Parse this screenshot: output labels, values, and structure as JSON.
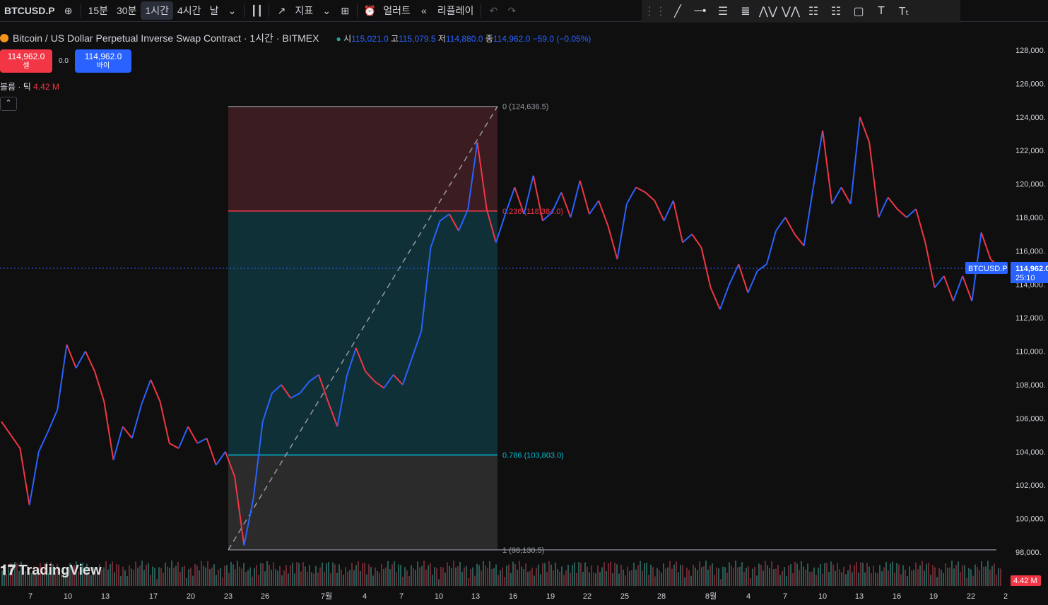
{
  "toolbar": {
    "symbol": "BTCUSD.P",
    "intervals": [
      "15분",
      "30분",
      "1시간",
      "4시간",
      "날"
    ],
    "active_interval": "1시간",
    "indicators_label": "지표",
    "alert_label": "얼러트",
    "replay_label": "리플레이"
  },
  "legend": {
    "title": "Bitcoin / US Dollar Perpetual Inverse Swap Contract · 1시간 · BITMEX",
    "o_label": "시",
    "o": "115,021.0",
    "h_label": "고",
    "h": "115,079.5",
    "l_label": "저",
    "l": "114,880.0",
    "c_label": "종",
    "c": "114,962.0",
    "change": "−59.0 (−0.05%)"
  },
  "trade": {
    "sell_price": "114,962.0",
    "sell_label": "셀",
    "spread": "0.0",
    "buy_price": "114,962.0",
    "buy_label": "바이"
  },
  "volume": {
    "label": "볼륨 · 틱",
    "value": "4.42 M"
  },
  "watermark": "TradingView",
  "price_label": {
    "symbol": "BTCUSD.P",
    "price": "114,962.0",
    "countdown": "25:10"
  },
  "volume_badge": "4.42 M",
  "colors": {
    "up": "#2962ff",
    "down": "#f23645",
    "background": "#0f0f0f",
    "fib_top": "#3a1c21",
    "fib_mid": "#0f3036",
    "fib_bottom": "#2b2b2b"
  },
  "chart_data": {
    "type": "line",
    "title": "",
    "ylim": [
      97000,
      129000
    ],
    "y_ticks": [
      98000,
      100000,
      102000,
      104000,
      106000,
      108000,
      110000,
      112000,
      114000,
      116000,
      118000,
      120000,
      122000,
      124000,
      126000,
      128000
    ],
    "x_ticks": [
      "7",
      "10",
      "13",
      "17",
      "20",
      "23",
      "26",
      "7월",
      "4",
      "7",
      "10",
      "13",
      "16",
      "19",
      "22",
      "25",
      "28",
      "8월",
      "4",
      "7",
      "10",
      "13",
      "16",
      "19",
      "22",
      "2"
    ],
    "series": [
      {
        "values": [
          105800,
          105000,
          104200,
          100800,
          104000,
          105200,
          106500,
          110400,
          109000,
          110000,
          108800,
          107000,
          103500,
          105500,
          104800,
          106800,
          108300,
          107000,
          104500,
          104200,
          105500,
          104500,
          104800,
          103200,
          104000,
          102500,
          98400,
          101200,
          105800,
          107500,
          108000,
          107200,
          107500,
          108200,
          108600,
          107000,
          105500,
          108500,
          110200,
          108800,
          108200,
          107800,
          108600,
          108000,
          109600,
          111200,
          116200,
          117800,
          118200,
          117200,
          118500,
          122500,
          118500,
          116500,
          118200,
          119800,
          118200,
          120500,
          117800,
          118300,
          119500,
          118000,
          120200,
          118200,
          119000,
          117500,
          115500,
          118800,
          119800,
          119500,
          119000,
          117800,
          119000,
          116500,
          117000,
          116200,
          113800,
          112500,
          114000,
          115200,
          113500,
          114800,
          115200,
          117200,
          118000,
          117000,
          116300,
          119800,
          123200,
          118800,
          119800,
          118800,
          124000,
          122500,
          118000,
          119200,
          118500,
          118000,
          118500,
          116500,
          113800,
          114500,
          113000,
          114500,
          113000,
          117100,
          115500,
          115000
        ]
      }
    ],
    "fibonacci": [
      {
        "level": "0",
        "price": 124636.5
      },
      {
        "level": "0.236",
        "price": 118384.0
      },
      {
        "level": "0.786",
        "price": 103803.0
      },
      {
        "level": "1",
        "price": 98130.5
      }
    ],
    "current_price": 114962.0
  }
}
